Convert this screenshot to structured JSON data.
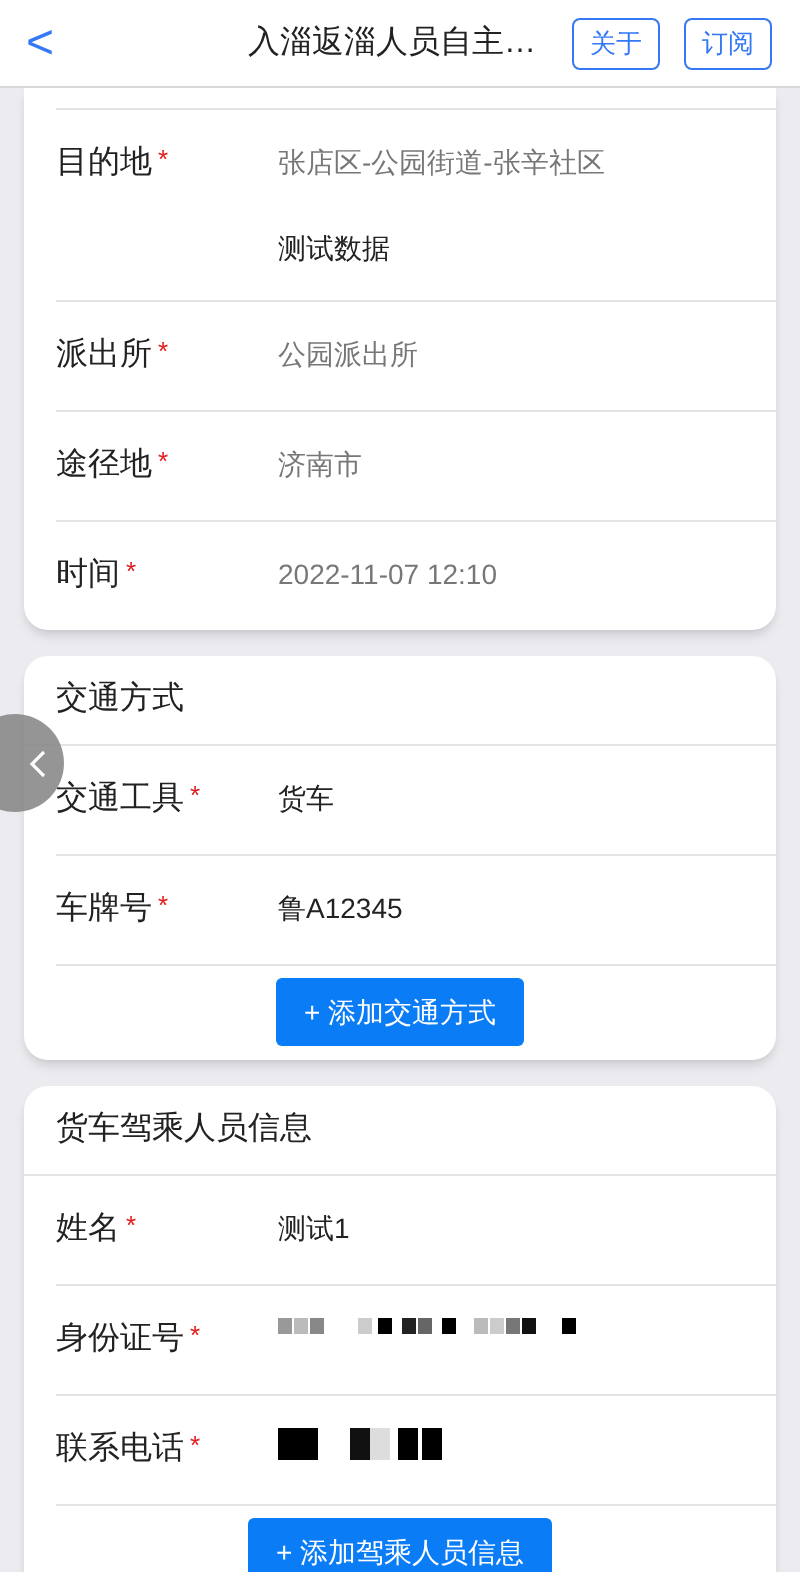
{
  "header": {
    "back": "<",
    "title": "入淄返淄人员自主…",
    "buttons": [
      "关于",
      "订阅"
    ]
  },
  "sections": [
    {
      "rows": [
        {
          "label": "目的地",
          "mark": "*",
          "value": "张店区-公园街道-张辛社区",
          "muted": true,
          "detail": "测试数据",
          "kind": "text"
        },
        {
          "label": "派出所",
          "mark": "*",
          "value": "公园派出所",
          "muted": true,
          "kind": "text"
        },
        {
          "label": "途径地",
          "mark": "*",
          "value": "济南市",
          "muted": true,
          "kind": "text"
        },
        {
          "label": "时间",
          "mark": "*",
          "value": "2022-11-07 12:10",
          "muted": true,
          "kind": "text"
        }
      ]
    },
    {
      "title": "交通方式",
      "rows": [
        {
          "label": "交通工具",
          "mark": "*",
          "value": "货车",
          "muted": false,
          "kind": "text"
        },
        {
          "label": "车牌号",
          "mark": "*",
          "value": "鲁A12345",
          "muted": false,
          "kind": "text"
        }
      ],
      "button": "+ 添加交通方式"
    },
    {
      "title": "货车驾乘人员信息",
      "rows": [
        {
          "label": "姓名",
          "mark": "*",
          "value": "测试1",
          "muted": false,
          "kind": "text"
        },
        {
          "label": "身份证号",
          "mark": "*",
          "kind": "redacted"
        },
        {
          "label": "联系电话",
          "mark": "*",
          "kind": "redacted"
        }
      ],
      "button": "+ 添加驾乘人员信息"
    }
  ]
}
